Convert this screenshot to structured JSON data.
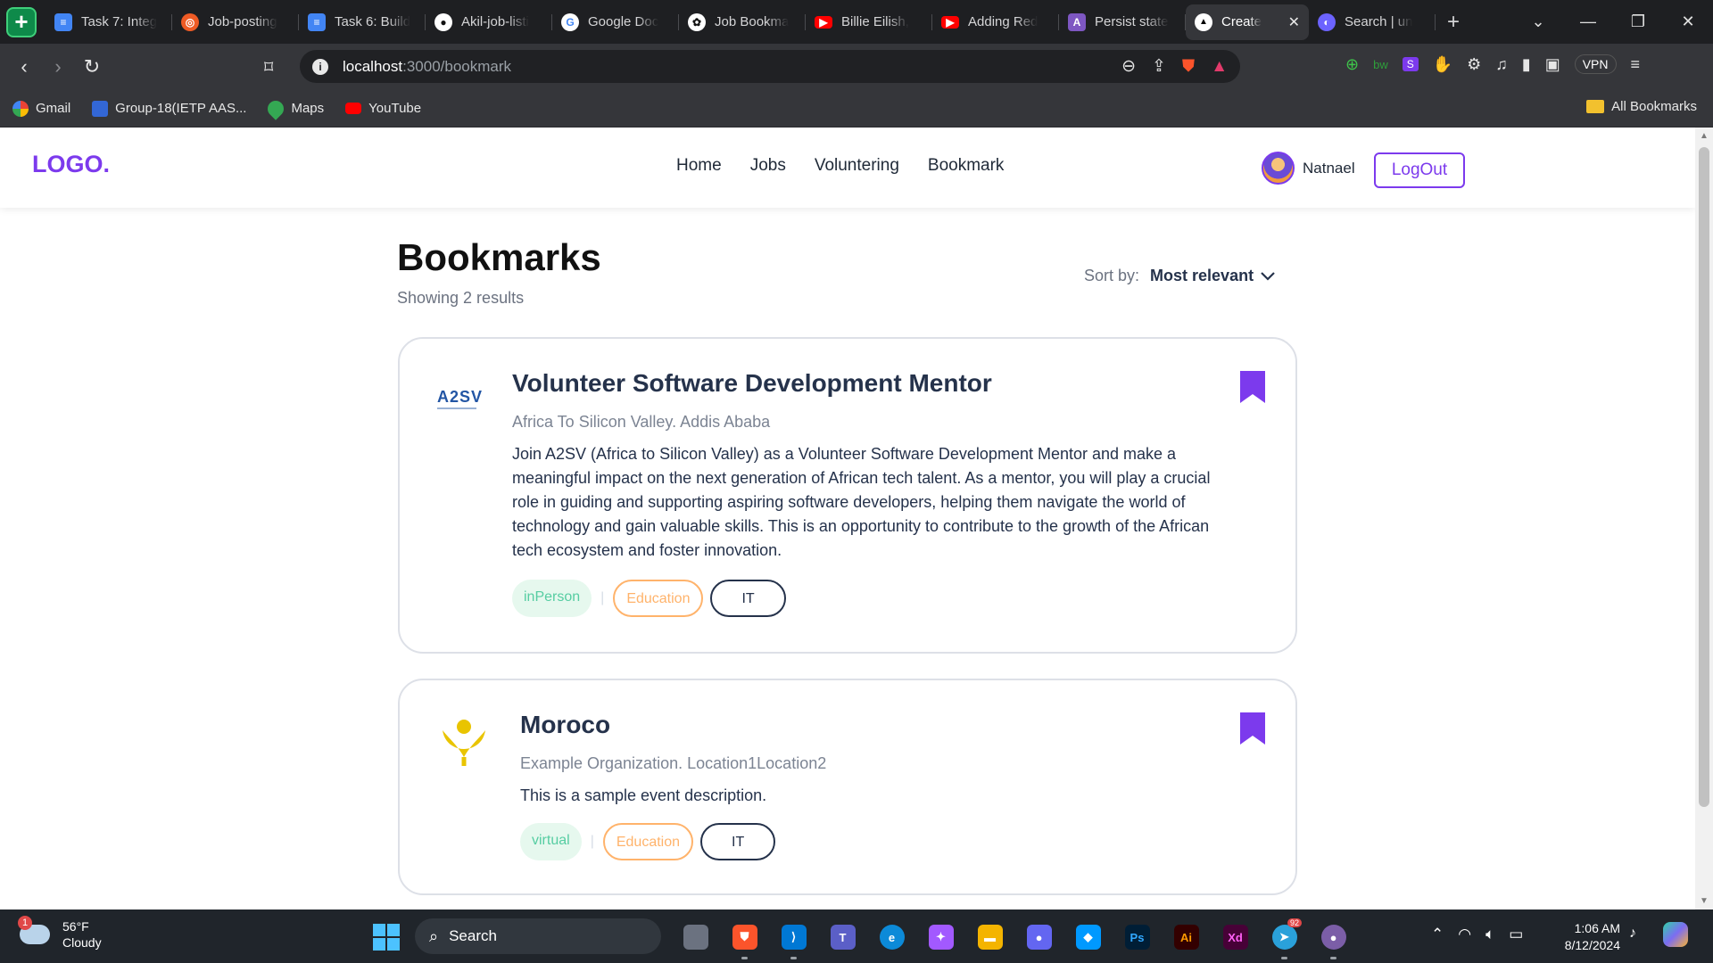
{
  "browser": {
    "app_badge": "+",
    "tabs": [
      {
        "title": "Task 7: Integ",
        "icon": "google-docs-icon",
        "color": "#4285f4"
      },
      {
        "title": "Job-posting",
        "icon": "postman-icon",
        "color": "#ef5b25"
      },
      {
        "title": "Task 6: Build",
        "icon": "google-docs-icon",
        "color": "#4285f4"
      },
      {
        "title": "Akil-job-listi",
        "icon": "github-icon",
        "color": "#ffffff"
      },
      {
        "title": "Google Doc",
        "icon": "google-icon",
        "color": "#ffffff"
      },
      {
        "title": "Job Bookma",
        "icon": "chatgpt-icon",
        "color": "#ffffff"
      },
      {
        "title": "Billie Eilish,",
        "icon": "youtube-icon",
        "color": "#ff0000"
      },
      {
        "title": "Adding Red",
        "icon": "youtube-icon",
        "color": "#ff0000"
      },
      {
        "title": "Persist state",
        "icon": "persist-icon",
        "color": "#7e57c2"
      },
      {
        "title": "Create",
        "icon": "vercel-icon",
        "color": "#ffffff"
      },
      {
        "title": "Search | un",
        "icon": "undraw-icon",
        "color": "#6c63ff"
      }
    ],
    "url_host": "localhost",
    "url_path": ":3000/bookmark",
    "vpn_label": "VPN",
    "bookmarks": [
      {
        "label": "Gmail",
        "color": "#ea4335"
      },
      {
        "label": "Group-18(IETP AAS...",
        "color": "#3367d6"
      },
      {
        "label": "Maps",
        "color": "#34a853"
      },
      {
        "label": "YouTube",
        "color": "#ff0000"
      }
    ],
    "all_bookmarks": "All Bookmarks"
  },
  "site": {
    "logo": "LOGO.",
    "nav": [
      "Home",
      "Jobs",
      "Voluntering",
      "Bookmark"
    ],
    "user_name": "Natnael",
    "logout_label": "LogOut",
    "accent": "#7c3aed"
  },
  "page": {
    "title": "Bookmarks",
    "results": "Showing 2 results",
    "sort_label": "Sort by:",
    "sort_value": "Most relevant"
  },
  "cards": [
    {
      "title": "Volunteer Software Development Mentor",
      "org": "Africa To Silicon Valley. Addis Ababa",
      "description": "Join A2SV (Africa to Silicon Valley) as a Volunteer Software Development Mentor and make a meaningful impact on the next generation of African tech talent. As a mentor, you will play a crucial role in guiding and supporting aspiring software developers, helping them navigate the world of technology and gain valuable skills. This is an opportunity to contribute to the growth of the African tech ecosystem and foster innovation.",
      "logo_text": "A2SV",
      "tags": [
        "inPerson",
        "Education",
        "IT"
      ],
      "bookmarked": true
    },
    {
      "title": "Moroco",
      "org": "Example Organization. Location1Location2",
      "description": "This is a sample event description.",
      "logo_text": "",
      "tags": [
        "virtual",
        "Education",
        "IT"
      ],
      "bookmarked": true
    }
  ],
  "taskbar": {
    "weather_temp": "56°F",
    "weather_desc": "Cloudy",
    "weather_badge": "1",
    "search_label": "Search",
    "telegram_badge": "92",
    "time": "1:06 AM",
    "date": "8/12/2024",
    "apps": [
      {
        "name": "file-explorer-taskview-icon",
        "color": "#6b7280",
        "label": ""
      },
      {
        "name": "brave-browser-icon",
        "color": "#fb542b",
        "label": ""
      },
      {
        "name": "vscode-icon",
        "color": "#0078d4",
        "label": ""
      },
      {
        "name": "teams-icon",
        "color": "#5b5fc7",
        "label": ""
      },
      {
        "name": "edge-icon",
        "color": "#0c8ad8",
        "label": ""
      },
      {
        "name": "figma-icon",
        "color": "#a259ff",
        "label": ""
      },
      {
        "name": "file-explorer-icon",
        "color": "#f4b400",
        "label": ""
      },
      {
        "name": "notion-like-icon",
        "color": "#6366f1",
        "label": ""
      },
      {
        "name": "framer-icon",
        "color": "#0099ff",
        "label": ""
      },
      {
        "name": "photoshop-icon",
        "color": "#001e36",
        "label": "Ps"
      },
      {
        "name": "illustrator-icon",
        "color": "#330000",
        "label": "Ai"
      },
      {
        "name": "xd-icon",
        "color": "#470137",
        "label": "Xd"
      },
      {
        "name": "telegram-icon",
        "color": "#2aa1da",
        "label": ""
      },
      {
        "name": "github-desktop-icon",
        "color": "#7b5ea7",
        "label": ""
      }
    ]
  }
}
